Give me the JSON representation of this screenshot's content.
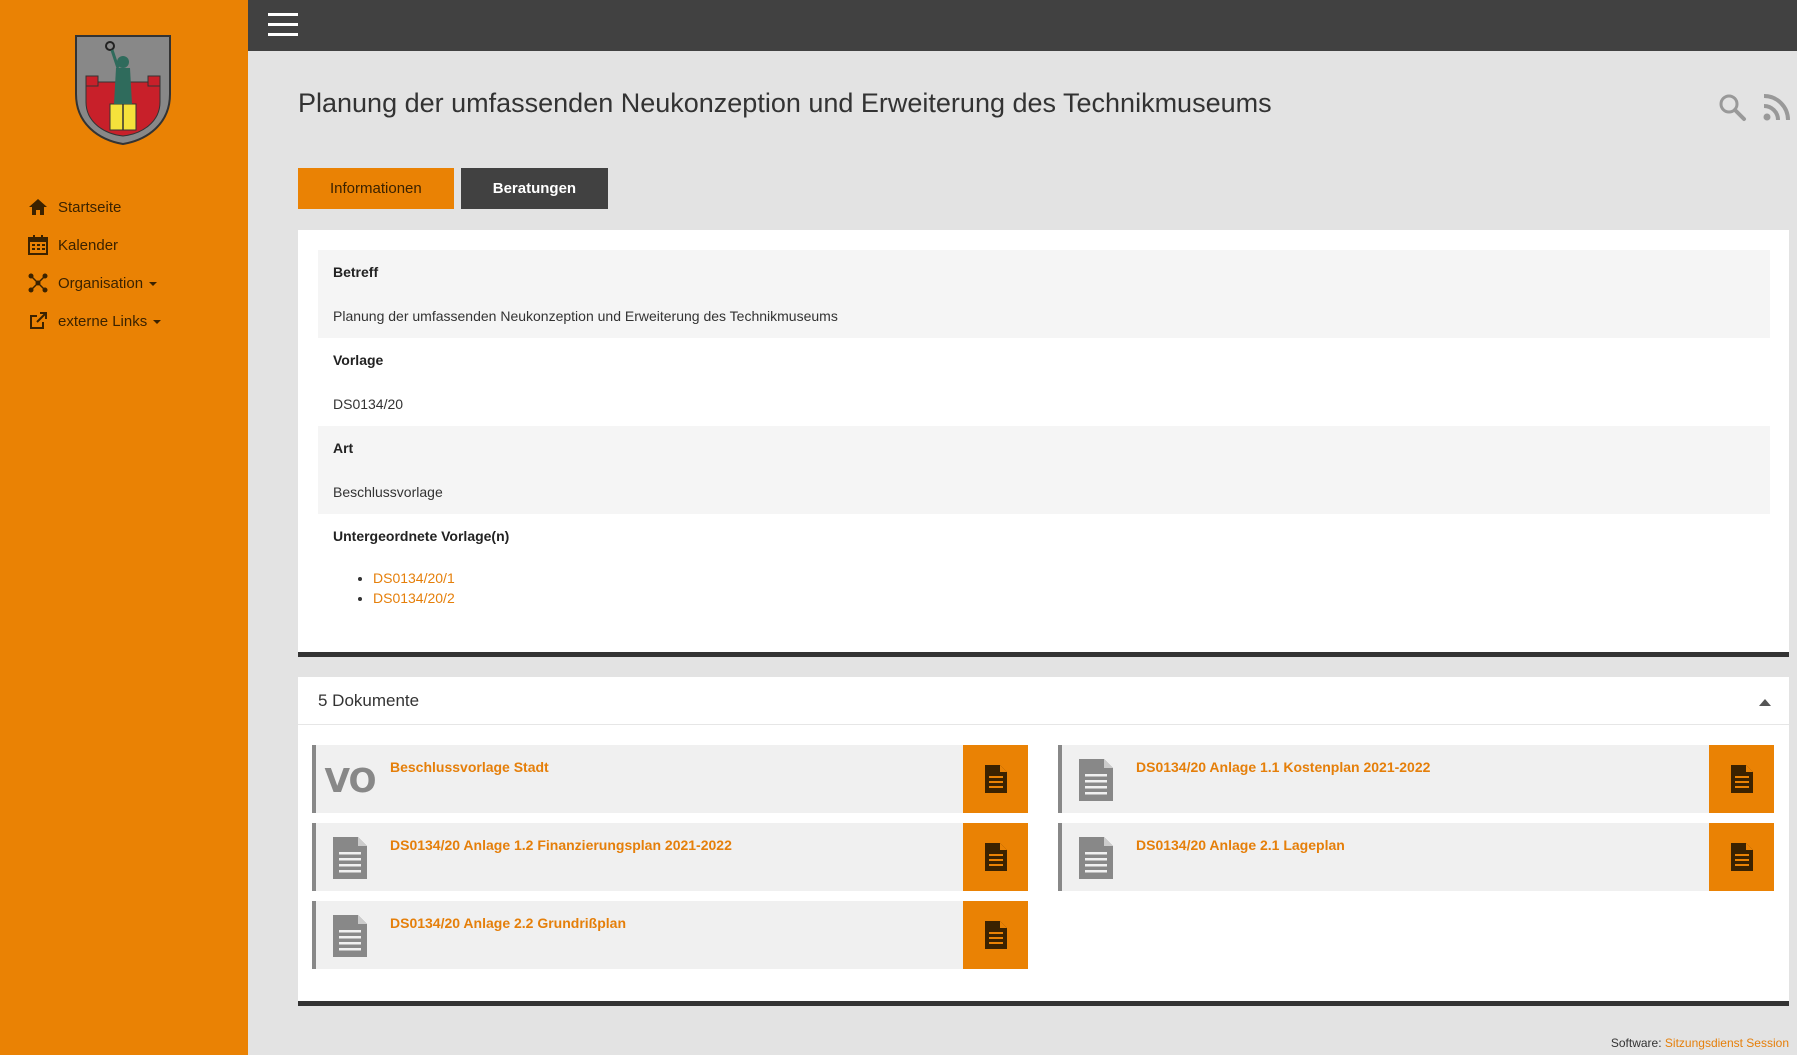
{
  "sidebar": {
    "items": [
      {
        "label": "Startseite",
        "icon": "home-icon"
      },
      {
        "label": "Kalender",
        "icon": "calendar-icon"
      },
      {
        "label": "Organisation",
        "icon": "organization-icon",
        "dropdown": true
      },
      {
        "label": "externe Links",
        "icon": "external-link-icon",
        "dropdown": true
      }
    ]
  },
  "page": {
    "title": "Planung der umfassenden Neukonzeption und Erweiterung des Technikmuseums"
  },
  "tabs": [
    {
      "label": "Informationen",
      "active": true
    },
    {
      "label": "Beratungen",
      "active": false
    }
  ],
  "info": {
    "betreff_label": "Betreff",
    "betreff_value": "Planung der umfassenden Neukonzeption und Erweiterung des Technikmuseums",
    "vorlage_label": "Vorlage",
    "vorlage_value": "DS0134/20",
    "art_label": "Art",
    "art_value": "Beschlussvorlage",
    "sub_label": "Untergeordnete Vorlage(n)",
    "sub_items": [
      "DS0134/20/1",
      "DS0134/20/2"
    ]
  },
  "documents": {
    "title": "5 Dokumente",
    "items": [
      {
        "name": "Beschlussvorlage Stadt",
        "thumb": "VO"
      },
      {
        "name": "DS0134/20 Anlage 1.1 Kostenplan 2021-2022",
        "thumb": "document-icon"
      },
      {
        "name": "DS0134/20 Anlage 1.2 Finanzierungsplan 2021-2022",
        "thumb": "document-icon"
      },
      {
        "name": "DS0134/20 Anlage 2.1 Lageplan",
        "thumb": "document-icon"
      },
      {
        "name": "DS0134/20 Anlage 2.2 Grundrißplan",
        "thumb": "document-icon"
      }
    ]
  },
  "footer": {
    "prefix": "Software:",
    "link": "Sitzungsdienst Session"
  },
  "colors": {
    "accent": "#ea8204",
    "topbar": "#414141",
    "link": "#e57f0a",
    "background": "#e3e3e3"
  }
}
